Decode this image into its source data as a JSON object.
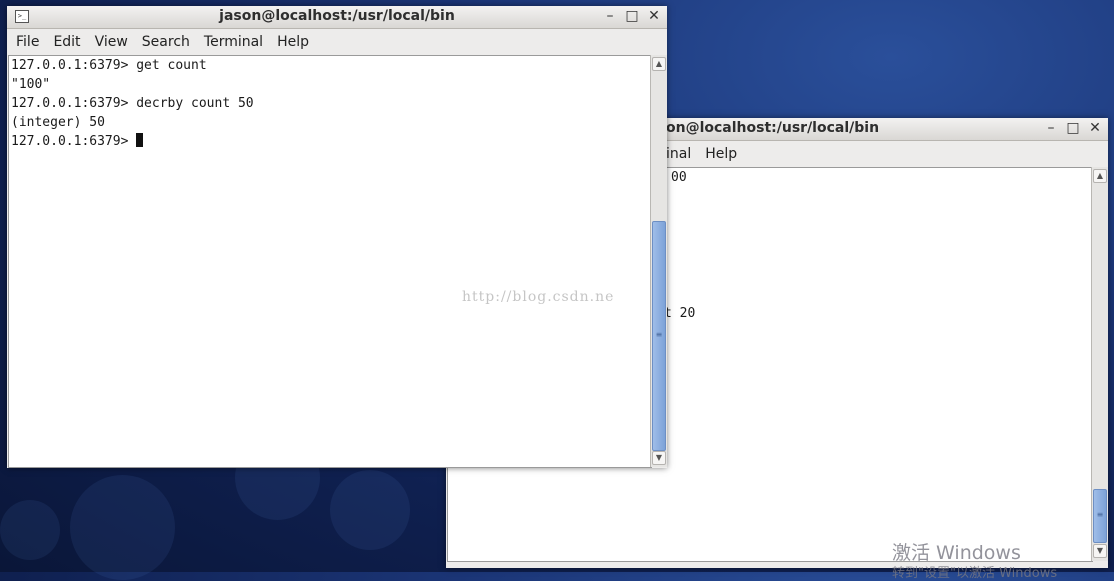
{
  "front_window": {
    "title": "jason@localhost:/usr/local/bin",
    "menu": [
      "File",
      "Edit",
      "View",
      "Search",
      "Terminal",
      "Help"
    ],
    "lines": [
      "127.0.0.1:6379> get count",
      "\"100\"",
      "127.0.0.1:6379> decrby count 50",
      "(integer) 50"
    ],
    "prompt": "127.0.0.1:6379> ",
    "buttons": {
      "minimize": "–",
      "maximize": "□",
      "close": "✕"
    }
  },
  "back_window": {
    "title_visible": "on@localhost:/usr/local/bin",
    "menu_visible": [
      "inal",
      "Help"
    ],
    "line_fragment_1": "00",
    "line_fragment_2": "t 20",
    "buttons": {
      "minimize": "–",
      "maximize": "□",
      "close": "✕"
    }
  },
  "watermark": "http://blog.csdn.ne",
  "activation": {
    "line1": "激活 Windows",
    "line2": "转到\"设置\"以激活 Windows"
  },
  "icons": {
    "terminal": "terminal-icon",
    "scroll_up": "scroll-up-arrow-icon",
    "scroll_down": "scroll-down-arrow-icon"
  }
}
